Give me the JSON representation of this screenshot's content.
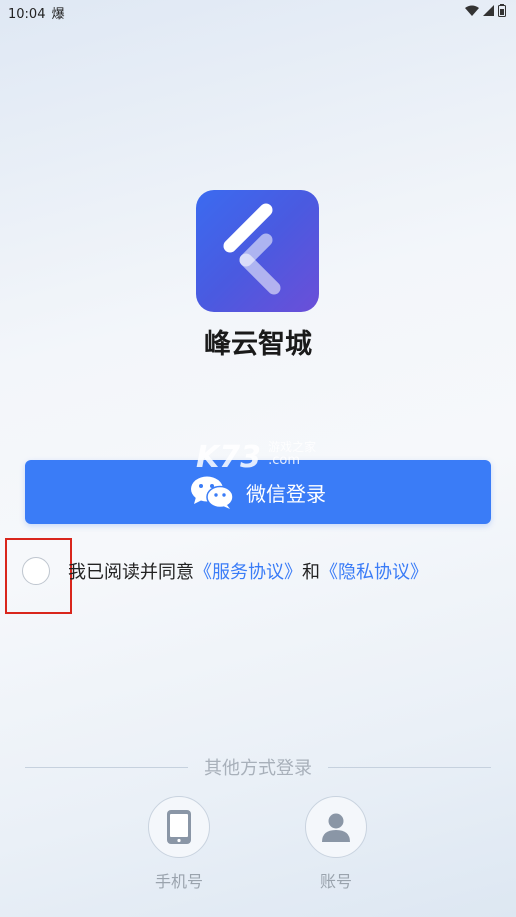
{
  "status": {
    "time": "10:04",
    "notification_glyph": "爆"
  },
  "app": {
    "name": "峰云智城"
  },
  "watermark": {
    "brand": "K73",
    "tagline": "游戏之家",
    "domain": ".com"
  },
  "login": {
    "wechat_label": "微信登录"
  },
  "agreement": {
    "prefix": "我已阅读并同意",
    "service_link": "《服务协议》",
    "conjunction": "和",
    "privacy_link": "《隐私协议》"
  },
  "other_login": {
    "title": "其他方式登录",
    "phone_label": "手机号",
    "account_label": "账号"
  },
  "colors": {
    "primary": "#3a7cf7",
    "highlight": "#d9261c"
  }
}
